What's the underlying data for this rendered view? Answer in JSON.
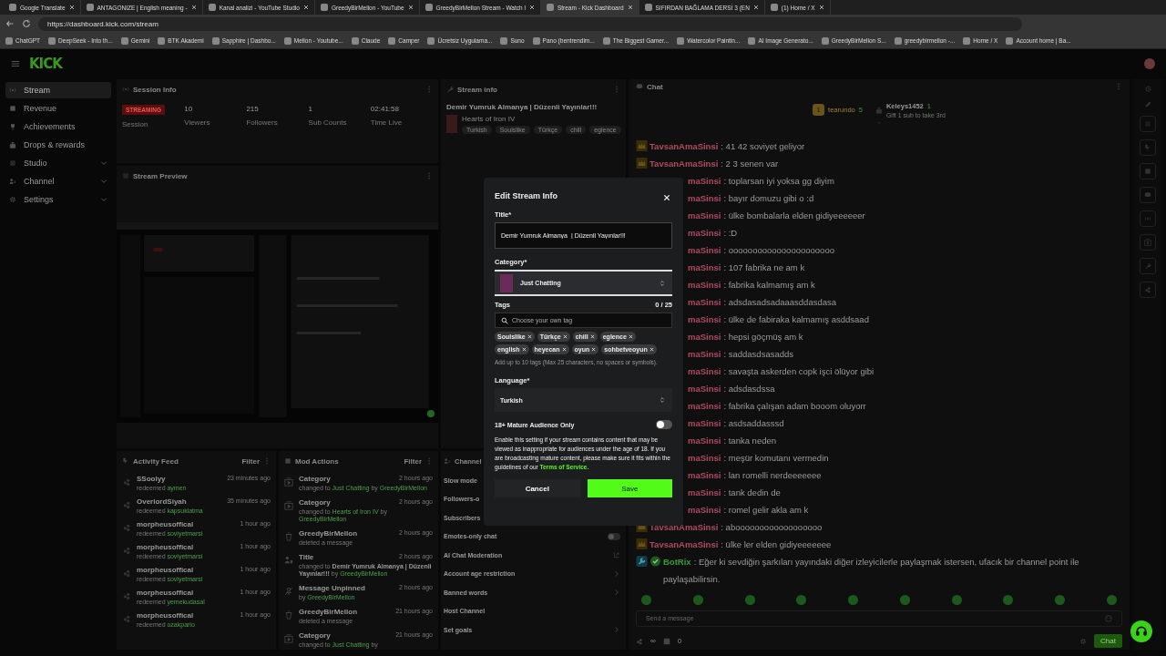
{
  "browser": {
    "tabs": [
      {
        "title": "Google Translate",
        "selected": false
      },
      {
        "title": "ANTAGONIZE | English meaning -",
        "selected": false
      },
      {
        "title": "Kanal analizi - YouTube Studio",
        "selected": false
      },
      {
        "title": "GreedyBirMellon - YouTube",
        "selected": false
      },
      {
        "title": "GreedyBirMellon Stream - Watch l",
        "selected": false
      },
      {
        "title": "Stream - Kick Dashboard",
        "selected": true
      },
      {
        "title": "SIFIRDAN BAĞLAMA DERSİ 3 (EN",
        "selected": false
      },
      {
        "title": "(1) Home / X",
        "selected": false
      }
    ],
    "url": "https://dashboard.kick.com/stream",
    "bookmarks": [
      "ChatGPT",
      "DeepSeek - Into th...",
      "Gemini",
      "BTK Akademi",
      "Sapphire | Dashbo...",
      "Mellon - Youtube...",
      "Claude",
      "Camper",
      "Ücretsiz Uygulama...",
      "Suno",
      "Pano (bentrendim...",
      "The Biggest Gamer...",
      "Watercolor Paintin...",
      "AI Image Generato...",
      "GreedyBirMellon S...",
      "greedybirmellon -...",
      "Home / X",
      "Account home | Ba..."
    ]
  },
  "nav": {
    "logo": "KICK"
  },
  "sidebar": {
    "items": [
      {
        "label": "Stream",
        "selected": true,
        "expandable": false
      },
      {
        "label": "Revenue",
        "selected": false,
        "expandable": false
      },
      {
        "label": "Achievements",
        "selected": false,
        "expandable": false
      },
      {
        "label": "Drops & rewards",
        "selected": false,
        "expandable": false
      },
      {
        "label": "Studio",
        "selected": false,
        "expandable": true
      },
      {
        "label": "Channel",
        "selected": false,
        "expandable": true
      },
      {
        "label": "Settings",
        "selected": false,
        "expandable": true
      }
    ]
  },
  "session_info": {
    "title": "Session Info",
    "status": "STREAMING",
    "status_label": "Session",
    "stats": [
      {
        "value": "10",
        "label": "Viewers"
      },
      {
        "value": "215",
        "label": "Followers"
      },
      {
        "value": "1",
        "label": "Sub Counts"
      },
      {
        "value": "02:41:58",
        "label": "Time Live"
      }
    ]
  },
  "stream_preview": {
    "title": "Stream Preview"
  },
  "stream_info": {
    "title": "Stream info",
    "stream_title": "Demir Yumruk Almanya | Düzenli Yayınlar!!!",
    "category": "Hearts of Iron IV",
    "tags": [
      "Turkish",
      "Soulslike",
      "Türkçe",
      "chill",
      "eglence"
    ]
  },
  "chat": {
    "title": "Chat",
    "leaderboard": [
      {
        "rank": "1",
        "name": "tearundo",
        "count": "5"
      },
      {
        "name": "Keleys1452",
        "count": "1",
        "note": "Gift 1 sub to take 3rd"
      }
    ],
    "messages": [
      {
        "kind": "full",
        "user": "TavsanAmaSinsi",
        "text": ": 41 42 soviyet geliyor"
      },
      {
        "kind": "full",
        "user": "TavsanAmaSinsi",
        "text": ": 2 3 senen var"
      },
      {
        "kind": "cut",
        "user": "maSinsi",
        "text": ": toplarsan iyi yoksa gg diyim"
      },
      {
        "kind": "cut",
        "user": "maSinsi",
        "text": ": bayır domuzu gibi o :d"
      },
      {
        "kind": "cut",
        "user": "maSinsi",
        "text": ": ülke bombalarla elden gidiyeeeeeer"
      },
      {
        "kind": "cut",
        "user": "maSinsi",
        "text": ": :D"
      },
      {
        "kind": "cut",
        "user": "maSinsi",
        "text": ": oooooooooooooooooooooo"
      },
      {
        "kind": "cut",
        "user": "maSinsi",
        "text": ": 107 fabrika ne am k"
      },
      {
        "kind": "cut",
        "user": "maSinsi",
        "text": ": fabrika kalmamış am k"
      },
      {
        "kind": "cut",
        "user": "maSinsi",
        "text": ": adsdasadsadaaasddasdasa"
      },
      {
        "kind": "cut",
        "user": "maSinsi",
        "text": ": ülke de fabiraka kalmamış asddsaad"
      },
      {
        "kind": "cut",
        "user": "maSinsi",
        "text": ": hepsi göçmüş am k"
      },
      {
        "kind": "cut",
        "user": "maSinsi",
        "text": ": saddasdsasadds"
      },
      {
        "kind": "cut",
        "user": "maSinsi",
        "text": ": savaşta askerden copk işci ölüyor gibi"
      },
      {
        "kind": "cut",
        "user": "maSinsi",
        "text": ": adsdasdssa"
      },
      {
        "kind": "cut",
        "user": "maSinsi",
        "text": ": fabrika çalışan adam booom oluyorr"
      },
      {
        "kind": "cut",
        "user": "maSinsi",
        "text": ": asdsaddasssd"
      },
      {
        "kind": "cut",
        "user": "maSinsi",
        "text": ": tanka neden"
      },
      {
        "kind": "cut",
        "user": "maSinsi",
        "text": ": meşür komutanı vermedin"
      },
      {
        "kind": "cut",
        "user": "maSinsi",
        "text": ": lan romelli nerdeeeeeee"
      },
      {
        "kind": "cut",
        "user": "maSinsi",
        "text": ": tank dedin de"
      },
      {
        "kind": "cut",
        "user": "maSinsi",
        "text": ": romel gelir akla am k"
      },
      {
        "kind": "full",
        "user": "TavsanAmaSinsi",
        "text": ": aboooooooooooooooooo"
      },
      {
        "kind": "full",
        "user": "TavsanAmaSinsi",
        "text": ": ülke ler elden gidiyeeeeeee"
      },
      {
        "kind": "bot",
        "user": "BotRix",
        "text": ": Eğer ki sevdiğin şarkıları yayındaki diğer izleyicilerle paylaşmak istersen, ufacık bir channel point ile paylaşabilirsin."
      }
    ],
    "placeholder": "Send a message",
    "points": "∞",
    "count": "0",
    "send": "Chat"
  },
  "activity_feed": {
    "title": "Activity Feed",
    "filter": "Filter",
    "items": [
      {
        "user": "SSoolyy",
        "action": "redeemed",
        "reward": "aymen",
        "time": "23 minutes ago"
      },
      {
        "user": "OverlordSiyah",
        "action": "redeemed",
        "reward": "kapsuklatma",
        "time": "35 minutes ago"
      },
      {
        "user": "morpheusoffical",
        "action": "redeemed",
        "reward": "soviyetmarsi",
        "time": "1 hour ago"
      },
      {
        "user": "morpheusoffical",
        "action": "redeemed",
        "reward": "soviyetmarsi",
        "time": "1 hour ago"
      },
      {
        "user": "morpheusoffical",
        "action": "redeemed",
        "reward": "soviyetmarsi",
        "time": "1 hour ago"
      },
      {
        "user": "morpheusoffical",
        "action": "redeemed",
        "reward": "yemekudasal",
        "time": "1 hour ago"
      },
      {
        "user": "morpheusoffical",
        "action": "redeemed",
        "reward": "ozakparlo",
        "time": "1 hour ago"
      }
    ]
  },
  "mod_actions": {
    "title": "Mod Actions",
    "filter": "Filter",
    "items": [
      {
        "kind": "category",
        "title": "Category",
        "time": "2 hours ago",
        "detail": [
          {
            "kind": "plain",
            "text": "changed to"
          },
          {
            "kind": "green",
            "text": "Just Chatting"
          },
          {
            "kind": "plain",
            "text": "by"
          },
          {
            "kind": "green",
            "text": "GreedyBirMellon"
          }
        ]
      },
      {
        "kind": "category",
        "title": "Category",
        "time": "2 hours ago",
        "detail": [
          {
            "kind": "plain",
            "text": "changed to"
          },
          {
            "kind": "green",
            "text": "Hearts of Iron IV"
          },
          {
            "kind": "plain",
            "text": "by"
          },
          {
            "kind": "green",
            "text": "GreedyBirMellon"
          }
        ]
      },
      {
        "kind": "delete",
        "title": "GreedyBirMellon",
        "time": "2 hours ago",
        "detail": [
          {
            "kind": "plain",
            "text": "deleted a message"
          }
        ]
      },
      {
        "kind": "title",
        "title": "Title",
        "time": "2 hours ago",
        "detail": [
          {
            "kind": "plain",
            "text": "changed to"
          },
          {
            "kind": "bold",
            "text": "Demir Yumruk Almanya | Düzenli Yayınlar!!!"
          },
          {
            "kind": "plain",
            "text": "by"
          },
          {
            "kind": "green",
            "text": "GreedyBirMellon"
          }
        ]
      },
      {
        "kind": "unpin",
        "title": "Message Unpinned",
        "time": "2 hours ago",
        "detail": [
          {
            "kind": "plain",
            "text": "by"
          },
          {
            "kind": "green",
            "text": "GreedyBirMellon"
          }
        ]
      },
      {
        "kind": "delete",
        "title": "GreedyBirMellon",
        "time": "21 hours ago",
        "detail": [
          {
            "kind": "plain",
            "text": "deleted a message"
          }
        ]
      },
      {
        "kind": "category",
        "title": "Category",
        "time": "21 hours ago",
        "detail": [
          {
            "kind": "plain",
            "text": "changed to"
          },
          {
            "kind": "green",
            "text": "Just Chatting"
          },
          {
            "kind": "plain",
            "text": "by"
          }
        ]
      }
    ]
  },
  "channel": {
    "title": "Channel",
    "settings": [
      {
        "label": "Slow mode",
        "kind": "none"
      },
      {
        "label": "Followers-o",
        "kind": "none"
      },
      {
        "label": "Subscribers",
        "kind": "none"
      },
      {
        "label": "Emotes-only chat",
        "kind": "toggle",
        "on": false
      },
      {
        "label": "AI Chat Moderation",
        "kind": "external"
      },
      {
        "label": "Account age restriction",
        "kind": "chevron"
      },
      {
        "label": "Banned words",
        "kind": "chevron"
      },
      {
        "label": "Host Channel",
        "kind": "none"
      },
      {
        "label": "Set goals",
        "kind": "chevron"
      }
    ]
  },
  "modal": {
    "title": "Edit Stream Info",
    "title_label": "Title*",
    "title_value": "Demir Yumruk Almanya  | Düzenli Yayınlar!!!",
    "category_label": "Category*",
    "category_value": "Just Chatting",
    "tags_label": "Tags",
    "tags_count": "0 / 25",
    "tags_placeholder": "Choose your own tag",
    "tags": [
      "Soulslike",
      "Türkçe",
      "chill",
      "eglence",
      "english",
      "heyecan",
      "oyun",
      "sohbetveoyun"
    ],
    "tags_hint": "Add up to 10 tags (Max 25 characters, no spaces or symbols).",
    "language_label": "Language*",
    "language_value": "Turkish",
    "mature_label": "18+ Mature Audience Only",
    "mature_on": false,
    "mature_desc": "Enable this setting if your stream contains content that may be viewed as inappropriate for audiences under the age of 18. If you are broadcasting mature content, please make sure it fits within the guidelines of our",
    "mature_link": "Terms of Service.",
    "cancel": "Cancel",
    "save": "Save"
  }
}
